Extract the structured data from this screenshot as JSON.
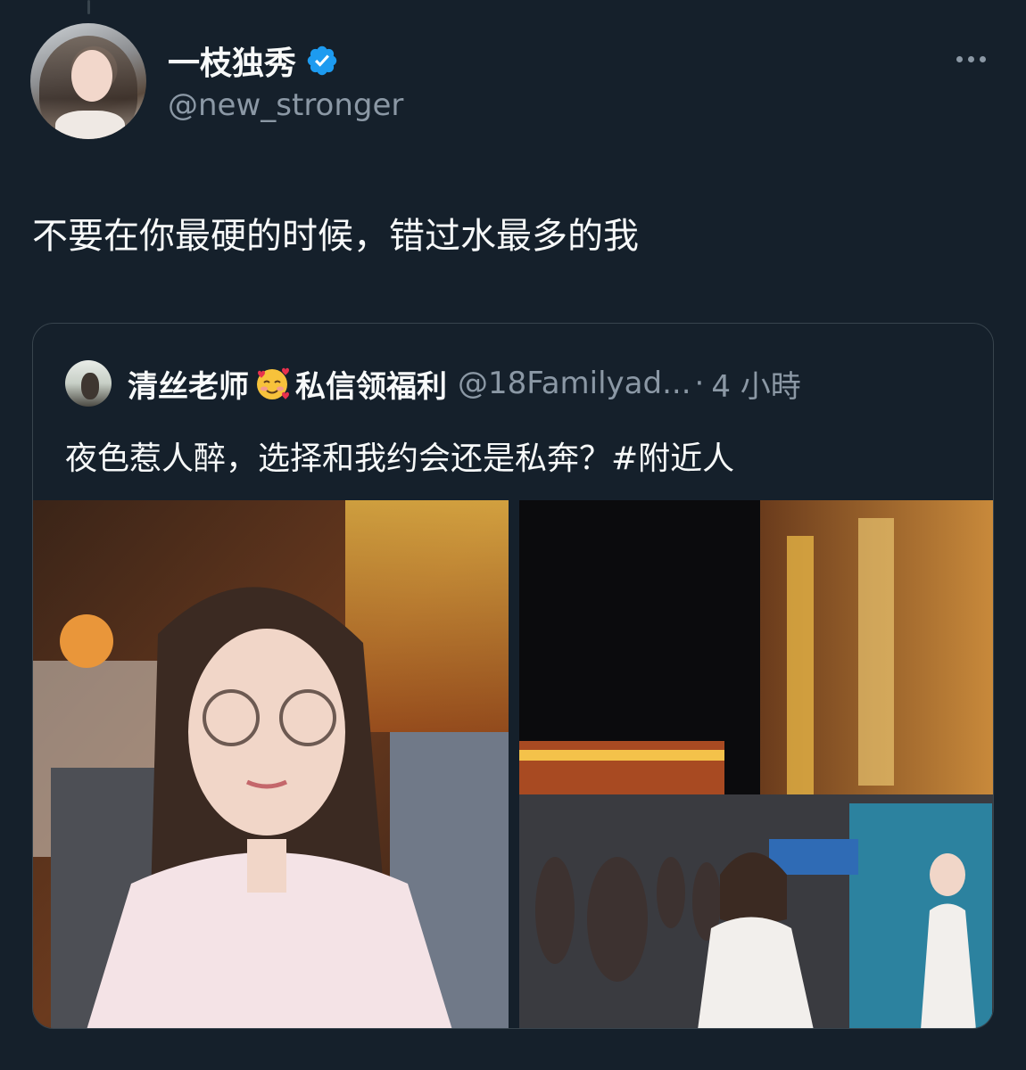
{
  "tweet": {
    "display_name": "一枝独秀",
    "handle": "@new_stronger",
    "text": "不要在你最硬的时候，错过水最多的我"
  },
  "quoted_tweet": {
    "name_part1": "清丝老师",
    "emoji": "smiling-face-with-hearts",
    "name_part2": "私信领福利",
    "handle": "@18Familyad...",
    "separator": "·",
    "time": "4 小時",
    "text": "夜色惹人醉，选择和我约会还是私奔？#附近人"
  },
  "colors": {
    "background": "#15202b",
    "primary_text": "#f7f9f9",
    "secondary_text": "#8b98a5",
    "border": "#38444d",
    "verified": "#1d9bf0"
  },
  "icons": [
    "verified-badge-icon",
    "more-options-icon"
  ]
}
